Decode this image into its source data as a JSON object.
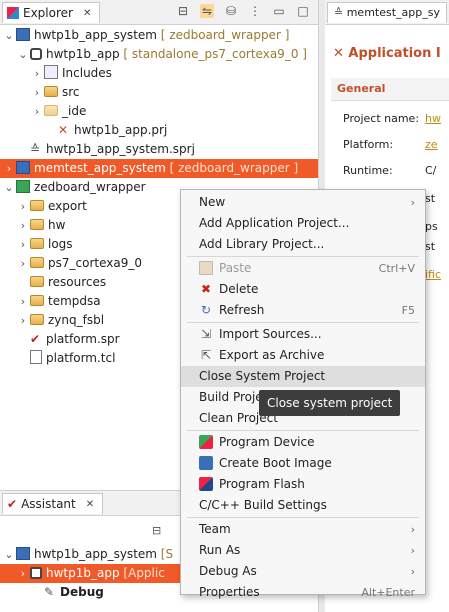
{
  "explorer": {
    "tab_label": "Explorer",
    "close": "✕",
    "tree": [
      {
        "name": "hwtp1b_app_system",
        "suffix": "[ zedboard_wrapper ]"
      },
      {
        "name": "hwtp1b_app",
        "suffix": "[ standalone_ps7_cortexa9_0 ]"
      },
      {
        "name": "Includes"
      },
      {
        "name": "src"
      },
      {
        "name": "_ide"
      },
      {
        "name": "hwtp1b_app.prj"
      },
      {
        "name": "hwtp1b_app_system.sprj"
      },
      {
        "name": "memtest_app_system",
        "suffix": "[ zedboard_wrapper ]"
      },
      {
        "name": "zedboard_wrapper"
      },
      {
        "name": "export"
      },
      {
        "name": "hw"
      },
      {
        "name": "logs"
      },
      {
        "name": "ps7_cortexa9_0"
      },
      {
        "name": "resources"
      },
      {
        "name": "tempdsa"
      },
      {
        "name": "zynq_fsbl"
      },
      {
        "name": "platform.spr"
      },
      {
        "name": "platform.tcl"
      }
    ]
  },
  "assistant": {
    "tab_label": "Assistant",
    "tree": [
      {
        "name": "hwtp1b_app_system",
        "suffix": "[S"
      },
      {
        "name": "hwtp1b_app",
        "suffix": "[Applic"
      },
      {
        "name": "Debug"
      }
    ]
  },
  "editor": {
    "tab_label": "memtest_app_sy",
    "title": "Application I",
    "section": "General",
    "fields": [
      {
        "label": "Project name:",
        "value": "hw"
      },
      {
        "label": "Platform:",
        "value": "ze"
      },
      {
        "label": "Runtime:",
        "value": "C/"
      }
    ],
    "extra": [
      "st",
      "ps",
      "st",
      "ific"
    ]
  },
  "menu": {
    "items": [
      {
        "label": "New",
        "shortcut": "",
        "submenu": true
      },
      {
        "label": "Add Application Project...",
        "shortcut": ""
      },
      {
        "label": "Add Library Project...",
        "shortcut": ""
      },
      {
        "label": "Paste",
        "shortcut": "Ctrl+V",
        "disabled": true,
        "icon": "paste-icon"
      },
      {
        "label": "Delete",
        "shortcut": "",
        "icon": "delete-icon"
      },
      {
        "label": "Refresh",
        "shortcut": "F5",
        "icon": "refresh-icon"
      },
      {
        "label": "Import Sources...",
        "shortcut": "",
        "icon": "import-icon"
      },
      {
        "label": "Export as Archive",
        "shortcut": "",
        "icon": "export-icon"
      },
      {
        "label": "Close System Project",
        "shortcut": ""
      },
      {
        "label": "Build Project",
        "shortcut": ""
      },
      {
        "label": "Clean Project",
        "shortcut": ""
      },
      {
        "label": "Program Device",
        "shortcut": "",
        "icon": "program-device-icon"
      },
      {
        "label": "Create Boot Image",
        "shortcut": "",
        "icon": "boot-image-icon"
      },
      {
        "label": "Program Flash",
        "shortcut": "",
        "icon": "program-flash-icon"
      },
      {
        "label": "C/C++ Build Settings",
        "shortcut": ""
      },
      {
        "label": "Team",
        "shortcut": "",
        "submenu": true
      },
      {
        "label": "Run As",
        "shortcut": "",
        "submenu": true
      },
      {
        "label": "Debug As",
        "shortcut": "",
        "submenu": true
      },
      {
        "label": "Properties",
        "shortcut": "Alt+Enter"
      }
    ],
    "tooltip": "Close system project"
  },
  "colors": {
    "selection": "#f05a28",
    "accent": "#c0502a"
  }
}
